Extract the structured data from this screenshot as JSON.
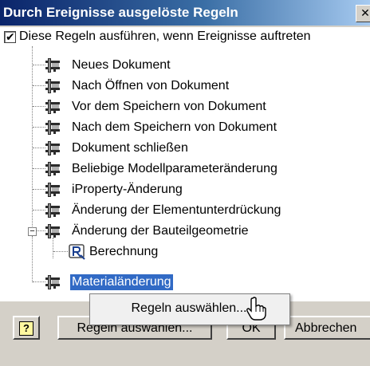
{
  "window": {
    "title": "Durch Ereignisse ausgelöste Regeln",
    "close_glyph": "✕"
  },
  "header": {
    "checkbox_checked": true,
    "check_glyph": "✔",
    "label": "Diese Regeln ausführen, wenn Ereignisse auftreten"
  },
  "tree": {
    "events": [
      "Neues Dokument",
      "Nach Öffnen von Dokument",
      "Vor dem Speichern von Dokument",
      "Nach dem Speichern von Dokument",
      "Dokument schließen",
      "Beliebige Modellparameteränderung",
      "iProperty-Änderung",
      "Änderung der Elementunterdrückung",
      "Änderung der Bauteilgeometrie"
    ],
    "expander_glyph": "−",
    "child_rule": "Berechnung",
    "selected_event": "Materialänderung"
  },
  "context_menu": {
    "item": "Regeln auswählen..."
  },
  "buttons": {
    "help": "?",
    "select_rules": "Regeln auswählen...",
    "ok": "OK",
    "cancel": "Abbrechen"
  },
  "icons": {
    "event": "rule-tree-icon",
    "rule": "ilogic-rule-icon",
    "cursor": "hand-pointer-icon"
  },
  "colors": {
    "selection": "#316ac5",
    "dialog_face": "#d4d0c8",
    "title_bar": "#0a246a"
  }
}
